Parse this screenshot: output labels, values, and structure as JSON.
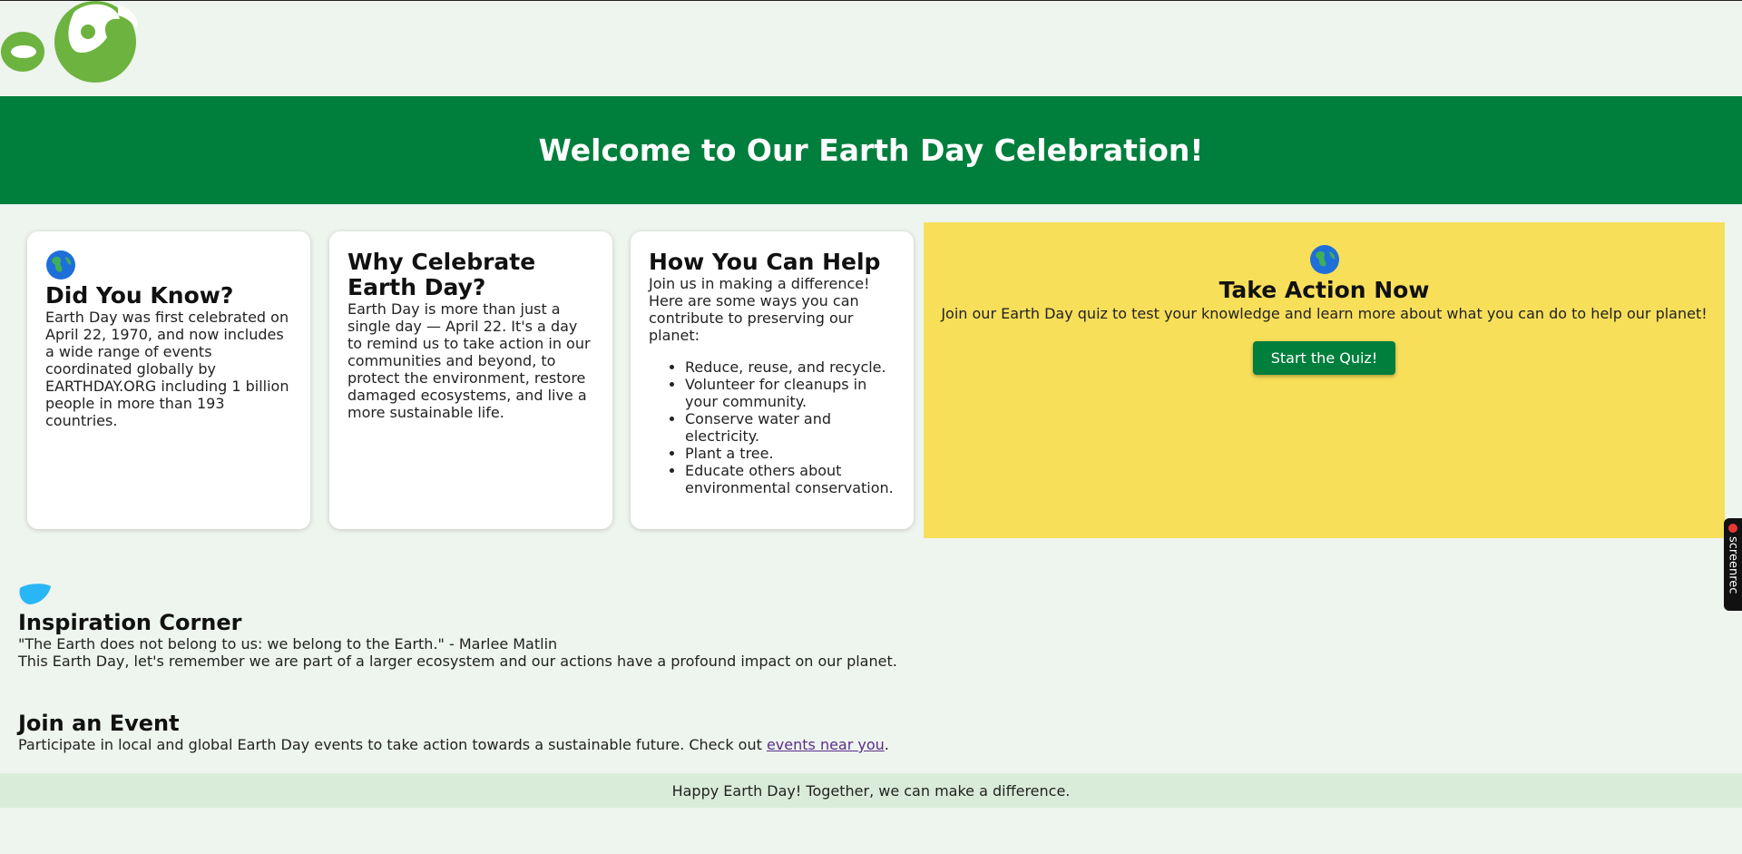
{
  "header": {
    "title": "Welcome to Our Earth Day Celebration!"
  },
  "cards": [
    {
      "title": "Did You Know?",
      "text": "Earth Day was first celebrated on April 22, 1970, and now includes a wide range of events coordinated globally by EARTHDAY.ORG including 1 billion people in more than 193 countries."
    },
    {
      "title": "Why Celebrate Earth Day?",
      "text": "Earth Day is more than just a single day — April 22. It's a day to remind us to take action in our communities and beyond, to protect the environment, restore damaged ecosystems, and live a more sustainable life."
    },
    {
      "title": "How You Can Help",
      "text": "Join us in making a difference! Here are some ways you can contribute to preserving our planet:",
      "items": [
        "Reduce, reuse, and recycle.",
        "Volunteer for cleanups in your community.",
        "Conserve water and electricity.",
        "Plant a tree.",
        "Educate others about environmental conservation."
      ]
    }
  ],
  "action": {
    "title": "Take Action Now",
    "text": "Join our Earth Day quiz to test your knowledge and learn more about what you can do to help our planet!",
    "button": "Start the Quiz!"
  },
  "inspiration": {
    "title": "Inspiration Corner",
    "quote": "\"The Earth does not belong to us: we belong to the Earth.\" - Marlee Matlin",
    "text": "This Earth Day, let's remember we are part of a larger ecosystem and our actions have a profound impact on our planet."
  },
  "event": {
    "title": "Join an Event",
    "text_before": "Participate in local and global Earth Day events to take action towards a sustainable future. Check out ",
    "link": "events near you",
    "text_after": "."
  },
  "footer": {
    "text": "Happy Earth Day! Together, we can make a difference."
  },
  "overlay": {
    "label": "screenrec"
  },
  "colors": {
    "banner": "#007e3c",
    "action_bg": "#f8df5a",
    "page_bg": "#eef4ee",
    "footer_bg": "#d9ecd9"
  }
}
